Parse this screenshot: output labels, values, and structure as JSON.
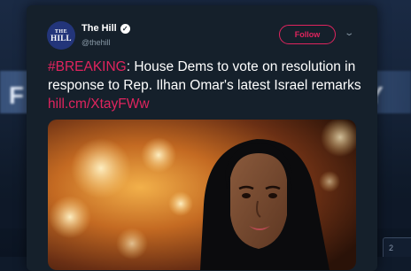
{
  "backdrop": {
    "left_text": "F",
    "right_text": "Y",
    "corner_text": "2"
  },
  "tweet": {
    "avatar_line1": "THE",
    "avatar_line2": "HILL",
    "display_name": "The Hill",
    "verified_icon": "verified-badge-icon",
    "handle": "@thehill",
    "follow_label": "Follow",
    "menu_icon": "chevron-down-icon",
    "hashtag": "#BREAKING",
    "body": ": House Dems to vote on resolution in response to Rep. Ilhan Omar's latest Israel remarks ",
    "link": "hill.cm/XtayFWw"
  },
  "colors": {
    "card_background": "#15202b",
    "accent": "#e0245e",
    "text": "#ffffff",
    "muted": "#8899a6",
    "avatar_background": "#23357a"
  }
}
